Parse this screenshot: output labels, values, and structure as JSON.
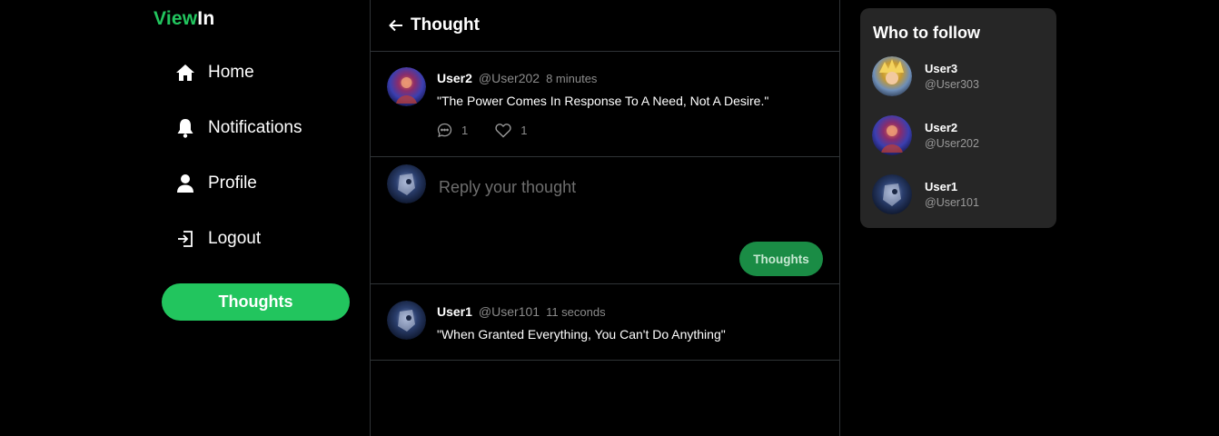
{
  "logo": {
    "part1": "View",
    "part2": "In"
  },
  "nav": [
    {
      "label": "Home",
      "icon": "home-icon"
    },
    {
      "label": "Notifications",
      "icon": "bell-icon"
    },
    {
      "label": "Profile",
      "icon": "user-icon"
    },
    {
      "label": "Logout",
      "icon": "logout-icon"
    }
  ],
  "compose_button": "Thoughts",
  "main": {
    "title": "Thought",
    "post": {
      "user": "User2",
      "handle": "@User202",
      "time": "8 minutes",
      "text": "\"The Power Comes In Response To A Need, Not A Desire.\"",
      "comments": "1",
      "likes": "1"
    },
    "reply": {
      "placeholder": "Reply your thought",
      "button": "Thoughts"
    },
    "replies": [
      {
        "user": "User1",
        "handle": "@User101",
        "time": "11 seconds",
        "text": "\"When Granted Everything, You Can't Do Anything\""
      }
    ]
  },
  "who_to_follow": {
    "title": "Who to follow",
    "users": [
      {
        "name": "User3",
        "handle": "@User303"
      },
      {
        "name": "User2",
        "handle": "@User202"
      },
      {
        "name": "User1",
        "handle": "@User101"
      }
    ]
  },
  "colors": {
    "accent": "#22c55e",
    "accent_dark": "#1a8c45",
    "panel": "#262626",
    "border": "#2f3336"
  }
}
